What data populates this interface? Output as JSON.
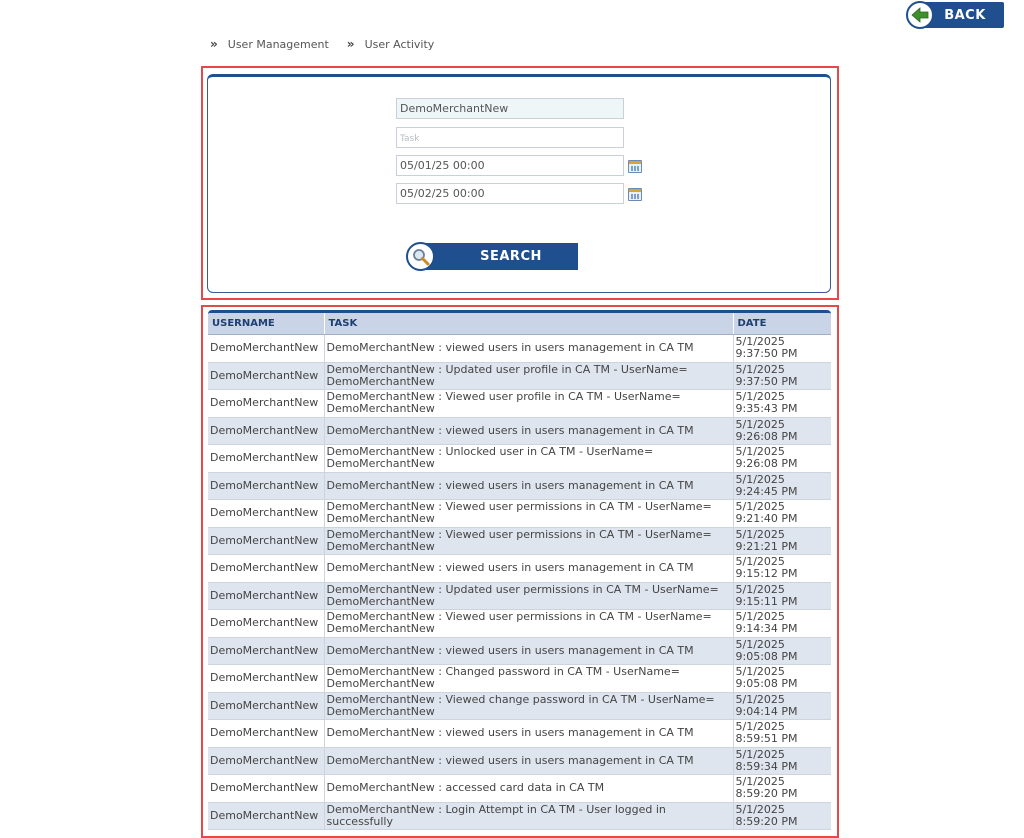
{
  "header": {
    "back_label": "BACK"
  },
  "breadcrumb": {
    "items": [
      "User Management",
      "User Activity"
    ],
    "separator": "»"
  },
  "search": {
    "username_value": "DemoMerchantNew",
    "task_placeholder": "Task",
    "task_value": "",
    "date_from_value": "05/01/25 00:00",
    "date_to_value": "05/02/25 00:00",
    "search_label": "SEARCH"
  },
  "table": {
    "columns": [
      "USERNAME",
      "TASK",
      "DATE"
    ],
    "rows": [
      {
        "username": "DemoMerchantNew",
        "task": "DemoMerchantNew : viewed users in users management in CA TM",
        "date": "5/1/2025 9:37:50 PM"
      },
      {
        "username": "DemoMerchantNew",
        "task": "DemoMerchantNew : Updated user profile in CA TM - UserName= DemoMerchantNew",
        "date": "5/1/2025 9:37:50 PM"
      },
      {
        "username": "DemoMerchantNew",
        "task": "DemoMerchantNew : Viewed user profile in CA TM - UserName= DemoMerchantNew",
        "date": "5/1/2025 9:35:43 PM"
      },
      {
        "username": "DemoMerchantNew",
        "task": "DemoMerchantNew : viewed users in users management in CA TM",
        "date": "5/1/2025 9:26:08 PM"
      },
      {
        "username": "DemoMerchantNew",
        "task": "DemoMerchantNew : Unlocked user in CA TM - UserName= DemoMerchantNew",
        "date": "5/1/2025 9:26:08 PM"
      },
      {
        "username": "DemoMerchantNew",
        "task": "DemoMerchantNew : viewed users in users management in CA TM",
        "date": "5/1/2025 9:24:45 PM"
      },
      {
        "username": "DemoMerchantNew",
        "task": "DemoMerchantNew : Viewed user permissions in CA TM - UserName= DemoMerchantNew",
        "date": "5/1/2025 9:21:40 PM"
      },
      {
        "username": "DemoMerchantNew",
        "task": "DemoMerchantNew : Viewed user permissions in CA TM - UserName= DemoMerchantNew",
        "date": "5/1/2025 9:21:21 PM"
      },
      {
        "username": "DemoMerchantNew",
        "task": "DemoMerchantNew : viewed users in users management in CA TM",
        "date": "5/1/2025 9:15:12 PM"
      },
      {
        "username": "DemoMerchantNew",
        "task": "DemoMerchantNew : Updated user permissions in CA TM - UserName= DemoMerchantNew",
        "date": "5/1/2025 9:15:11 PM"
      },
      {
        "username": "DemoMerchantNew",
        "task": "DemoMerchantNew : Viewed user permissions in CA TM - UserName= DemoMerchantNew",
        "date": "5/1/2025 9:14:34 PM"
      },
      {
        "username": "DemoMerchantNew",
        "task": "DemoMerchantNew : viewed users in users management in CA TM",
        "date": "5/1/2025 9:05:08 PM"
      },
      {
        "username": "DemoMerchantNew",
        "task": "DemoMerchantNew : Changed password in CA TM - UserName= DemoMerchantNew",
        "date": "5/1/2025 9:05:08 PM"
      },
      {
        "username": "DemoMerchantNew",
        "task": "DemoMerchantNew : Viewed change password in CA TM - UserName= DemoMerchantNew",
        "date": "5/1/2025 9:04:14 PM"
      },
      {
        "username": "DemoMerchantNew",
        "task": "DemoMerchantNew : viewed users in users management in CA TM",
        "date": "5/1/2025 8:59:51 PM"
      },
      {
        "username": "DemoMerchantNew",
        "task": "DemoMerchantNew : viewed users in users management in CA TM",
        "date": "5/1/2025 8:59:34 PM"
      },
      {
        "username": "DemoMerchantNew",
        "task": "DemoMerchantNew : accessed card data in CA TM",
        "date": "5/1/2025 8:59:20 PM"
      },
      {
        "username": "DemoMerchantNew",
        "task": "DemoMerchantNew : Login Attempt in CA TM - User logged in successfully",
        "date": "5/1/2025 8:59:20 PM"
      }
    ]
  },
  "colors": {
    "primary": "#1f4f8f",
    "highlight_outline": "#e24b4b",
    "header_row": "#c9d5e6",
    "alt_row": "#dfe5ef",
    "back_arrow": "#3f8f2f"
  },
  "icons": {
    "back": "arrow-left-icon",
    "search": "magnifier-icon",
    "calendar": "calendar-icon",
    "breadcrumb": "double-chevron-icon"
  }
}
